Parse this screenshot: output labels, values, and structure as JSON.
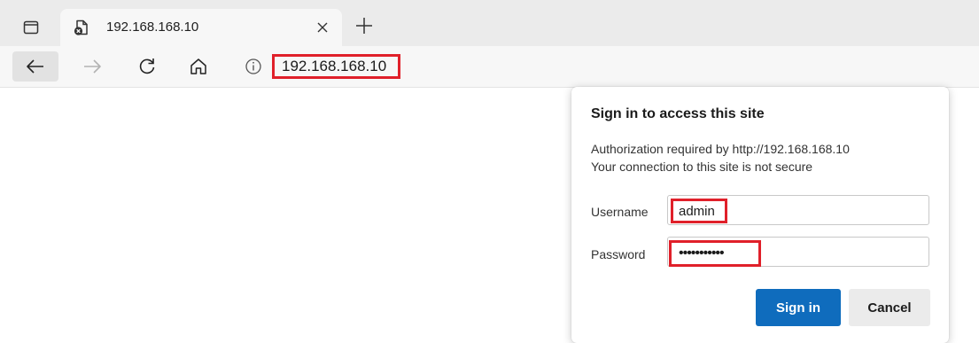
{
  "tab": {
    "title": "192.168.168.10",
    "icons": {
      "tab_actions": "tab-actions-icon",
      "favicon": "insecure-page-icon",
      "close": "close-icon",
      "new_tab": "plus-icon"
    }
  },
  "toolbar": {
    "icons": [
      "back-arrow-icon",
      "forward-arrow-icon",
      "reload-icon",
      "home-icon",
      "info-icon"
    ],
    "url": "192.168.168.10"
  },
  "dialog": {
    "title": "Sign in to access this site",
    "line1": "Authorization required by http://192.168.168.10",
    "line2": "Your connection to this site is not secure",
    "username_label": "Username",
    "username_value": "admin",
    "password_label": "Password",
    "password_value": "•••••••••••",
    "signin_label": "Sign in",
    "cancel_label": "Cancel"
  },
  "colors": {
    "highlight": "#e0202a",
    "primary_button": "#0f6cbd",
    "tab_strip": "#ebebeb",
    "toolbar": "#f7f7f7"
  }
}
